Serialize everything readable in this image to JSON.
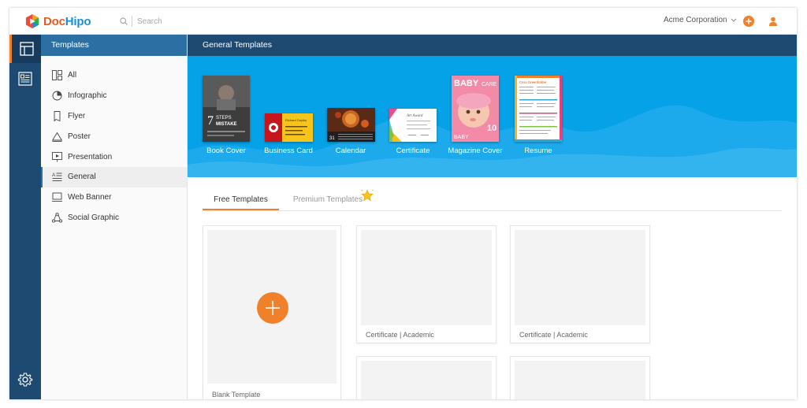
{
  "app": {
    "logo_part1": "Doc",
    "logo_part2": "Hipo"
  },
  "search": {
    "placeholder": "Search"
  },
  "header": {
    "organization": "Acme Corporation"
  },
  "sidebar": {
    "title": "Templates",
    "items": [
      {
        "label": "All",
        "icon": "grid-icon"
      },
      {
        "label": "Infographic",
        "icon": "pie-chart-icon"
      },
      {
        "label": "Flyer",
        "icon": "flyer-icon"
      },
      {
        "label": "Poster",
        "icon": "triangle-icon"
      },
      {
        "label": "Presentation",
        "icon": "presentation-icon"
      },
      {
        "label": "General",
        "icon": "text-lines-icon",
        "active": true
      },
      {
        "label": "Web Banner",
        "icon": "monitor-icon"
      },
      {
        "label": "Social Graphic",
        "icon": "share-network-icon"
      }
    ]
  },
  "main": {
    "title": "General Templates",
    "categories": [
      {
        "label": "Book Cover"
      },
      {
        "label": "Business Card"
      },
      {
        "label": "Calendar"
      },
      {
        "label": "Certificate"
      },
      {
        "label": "Magazine Cover"
      },
      {
        "label": "Resume"
      }
    ],
    "tabs": [
      {
        "label": "Free Templates",
        "active": true
      },
      {
        "label": "Premium Templates",
        "active": false
      }
    ],
    "cards": [
      {
        "label": "Blank Template"
      },
      {
        "label": "Certificate | Academic"
      },
      {
        "label": "Certificate | Academic"
      },
      {
        "label": ""
      },
      {
        "label": ""
      }
    ]
  },
  "thumbnails": {
    "book_cover": {
      "line1": "7",
      "line2": "STEPS",
      "line3": "MISTAKE"
    },
    "business_card": {
      "line1": "Richard Doyley"
    },
    "certificate": {
      "line1": "Art Award"
    },
    "magazine_cover": {
      "title1": "BABY",
      "title2": "CARE",
      "number": "10",
      "footer": "BABY"
    },
    "resume": {
      "name": "Cora Greenfolder"
    }
  },
  "colors": {
    "accent": "#f0802a",
    "navy": "#1e4a72",
    "blue": "#2c6fa3",
    "banner": "#06a2e8"
  }
}
